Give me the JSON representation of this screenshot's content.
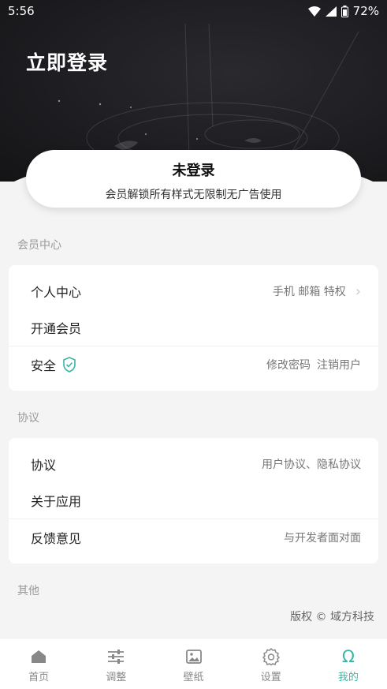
{
  "status_bar": {
    "time": "5:56",
    "battery": "72%"
  },
  "hero": {
    "title": "立即登录"
  },
  "login_card": {
    "title": "未登录",
    "subtitle": "会员解锁所有样式无限制无广告使用"
  },
  "sections": {
    "member": {
      "label": "会员中心",
      "rows": {
        "personal": {
          "label": "个人中心",
          "detail": "手机 邮箱 特权"
        },
        "vip": {
          "label": "开通会员"
        },
        "security": {
          "label": "安全",
          "detail1": "修改密码",
          "detail2": "注销用户"
        }
      }
    },
    "agreement": {
      "label": "协议",
      "rows": {
        "agreement": {
          "label": "协议",
          "detail": "用户协议、隐私协议"
        },
        "about": {
          "label": "关于应用"
        },
        "feedback": {
          "label": "反馈意见",
          "detail": "与开发者面对面"
        }
      }
    },
    "other": {
      "label": "其他"
    }
  },
  "copyright": "版权 © 域方科技",
  "tabbar": {
    "items": [
      {
        "label": "首页",
        "icon": "home-icon"
      },
      {
        "label": "调整",
        "icon": "sliders-icon"
      },
      {
        "label": "壁纸",
        "icon": "image-icon"
      },
      {
        "label": "设置",
        "icon": "gear-icon"
      },
      {
        "label": "我的",
        "icon": "omega-icon"
      }
    ],
    "active_index": 4
  },
  "colors": {
    "accent": "#3bb6a6",
    "hero_bg": "#1e1e22",
    "page_bg": "#f4f4f4"
  }
}
